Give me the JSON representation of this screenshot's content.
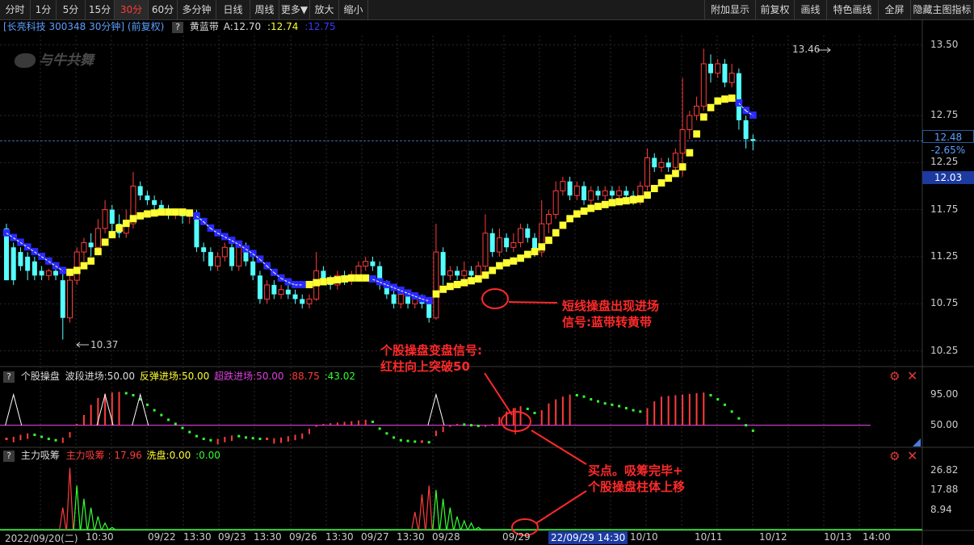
{
  "toolbar": {
    "left": [
      "分时",
      "1分",
      "5分",
      "15分",
      "30分",
      "60分",
      "多分钟",
      "日线",
      "周线",
      "更多▼",
      "放大",
      "缩小"
    ],
    "right": [
      "附加显示",
      "前复权",
      "画线",
      "特色画线",
      "全屏",
      "隐藏主图指标"
    ],
    "active": "30分"
  },
  "info": {
    "stock": "[长亮科技 300348 30分钟] (前复权)",
    "indicator_q": "?",
    "indicator": "黄蓝带",
    "a_label": "A:12.70",
    "val2": ":12.74",
    "val3": ":12.75"
  },
  "watermark": "与牛共舞",
  "price_panel": {
    "y_ticks": [
      "13.50",
      "12.75",
      "12.25",
      "11.75",
      "11.25",
      "10.75",
      "10.25"
    ],
    "high_label": "13.46",
    "low_label": "10.37",
    "last_price": "12.48",
    "last_change": "-2.65%",
    "cursor_price": "12.03"
  },
  "panel2": {
    "q": "?",
    "title": "个股操盘",
    "wave": "波段进场:50.00",
    "rebound": "反弹进场:50.00",
    "oversold": "超跌进场:50.00",
    "v1": ":88.75",
    "v2": ":43.02",
    "y_ticks": [
      "95.00",
      "50.00"
    ]
  },
  "panel3": {
    "q": "?",
    "title": "主力吸筹",
    "main": "主力吸筹 :",
    "main_val": "17.96",
    "wash": "洗盘:0.00",
    "v": ":0.00",
    "y_ticks": [
      "26.82",
      "17.88",
      "8.94"
    ]
  },
  "x_axis": {
    "labels": [
      "2022/09/20(二)",
      "10:30",
      "09/22",
      "13:30",
      "09/23",
      "13:30",
      "09/26",
      "13:30",
      "09/27",
      "13:30",
      "09/28",
      "09/29",
      "10/10",
      "10/11",
      "10/12",
      "10/13",
      "14:00"
    ],
    "cursor": "22/09/29 14:30"
  },
  "annotations": {
    "a1": [
      "短线操盘出现进场",
      "信号:蓝带转黄带"
    ],
    "a2": [
      "个股操盘变盘信号:",
      "红柱向上突破50"
    ],
    "a3": [
      "买点。吸筹完毕+",
      "个股操盘柱体上移"
    ]
  },
  "colors": {
    "up": "#ff3c3c",
    "down": "#54ffff",
    "yellow_band": "#ffff33",
    "blue_band": "#2a2aff",
    "green": "#33ff33",
    "magenta": "#e040e0",
    "annotation": "#ff2a2a"
  },
  "chart_data": {
    "type": "candlestick",
    "ylim": [
      10.1,
      13.6
    ],
    "candles": [
      [
        11.55,
        11.0,
        11.6,
        11.0
      ],
      [
        11.35,
        11.0,
        11.4,
        10.95
      ],
      [
        11.3,
        11.15,
        11.35,
        11.1
      ],
      [
        11.25,
        11.1,
        11.3,
        11.0
      ],
      [
        11.2,
        11.05,
        11.25,
        11.0
      ],
      [
        11.1,
        11.05,
        11.15,
        11.0
      ],
      [
        11.05,
        11.1,
        11.12,
        11.0
      ],
      [
        11.1,
        11.05,
        11.12,
        11.0
      ],
      [
        11.0,
        10.6,
        11.1,
        10.37
      ],
      [
        10.6,
        11.0,
        11.05,
        10.55
      ],
      [
        11.0,
        11.3,
        11.35,
        10.95
      ],
      [
        11.3,
        11.4,
        11.45,
        11.2
      ],
      [
        11.4,
        11.35,
        11.5,
        11.25
      ],
      [
        11.35,
        11.55,
        11.65,
        11.3
      ],
      [
        11.55,
        11.75,
        11.85,
        11.5
      ],
      [
        11.75,
        11.6,
        11.8,
        11.5
      ],
      [
        11.6,
        11.5,
        11.7,
        11.45
      ],
      [
        11.5,
        11.6,
        11.75,
        11.45
      ],
      [
        11.6,
        12.0,
        12.15,
        11.55
      ],
      [
        12.0,
        11.9,
        12.05,
        11.85
      ],
      [
        11.9,
        11.85,
        11.95,
        11.8
      ],
      [
        11.85,
        11.8,
        11.9,
        11.7
      ],
      [
        11.8,
        11.75,
        11.85,
        11.7
      ],
      [
        11.75,
        11.7,
        11.8,
        11.65
      ],
      [
        11.7,
        11.72,
        11.75,
        11.65
      ],
      [
        11.72,
        11.68,
        11.75,
        11.6
      ],
      [
        11.68,
        11.7,
        11.72,
        11.6
      ],
      [
        11.7,
        11.35,
        11.75,
        11.3
      ],
      [
        11.35,
        11.3,
        11.4,
        11.2
      ],
      [
        11.3,
        11.15,
        11.35,
        11.1
      ],
      [
        11.15,
        11.25,
        11.3,
        11.1
      ],
      [
        11.25,
        11.35,
        11.4,
        11.2
      ],
      [
        11.35,
        11.15,
        11.4,
        11.1
      ],
      [
        11.15,
        11.35,
        11.4,
        11.1
      ],
      [
        11.35,
        11.2,
        11.4,
        11.15
      ],
      [
        11.2,
        11.05,
        11.25,
        11.0
      ],
      [
        11.05,
        10.8,
        11.1,
        10.75
      ],
      [
        10.8,
        10.95,
        11.0,
        10.75
      ],
      [
        10.95,
        10.85,
        11.0,
        10.8
      ],
      [
        10.85,
        10.9,
        10.95,
        10.8
      ],
      [
        10.9,
        10.85,
        10.95,
        10.8
      ],
      [
        10.85,
        10.8,
        10.9,
        10.75
      ],
      [
        10.8,
        10.75,
        10.85,
        10.7
      ],
      [
        10.75,
        10.8,
        10.85,
        10.7
      ],
      [
        10.8,
        11.1,
        11.3,
        10.78
      ],
      [
        11.1,
        11.0,
        11.15,
        10.95
      ],
      [
        11.0,
        10.95,
        11.05,
        10.9
      ],
      [
        10.95,
        11.05,
        11.1,
        10.9
      ],
      [
        11.05,
        11.0,
        11.1,
        10.95
      ],
      [
        11.0,
        11.05,
        11.1,
        10.95
      ],
      [
        11.05,
        11.15,
        11.2,
        11.0
      ],
      [
        11.15,
        11.2,
        11.25,
        11.1
      ],
      [
        11.2,
        11.15,
        11.25,
        11.1
      ],
      [
        11.15,
        10.95,
        11.2,
        10.9
      ],
      [
        10.95,
        10.85,
        11.0,
        10.8
      ],
      [
        10.85,
        10.75,
        10.9,
        10.7
      ],
      [
        10.75,
        10.85,
        10.9,
        10.7
      ],
      [
        10.85,
        10.75,
        10.9,
        10.7
      ],
      [
        10.75,
        10.8,
        10.85,
        10.7
      ],
      [
        10.8,
        10.75,
        10.85,
        10.7
      ],
      [
        10.75,
        10.6,
        10.8,
        10.55
      ],
      [
        10.6,
        11.3,
        11.6,
        10.58
      ],
      [
        11.3,
        11.05,
        11.35,
        10.95
      ],
      [
        11.05,
        11.1,
        11.15,
        11.0
      ],
      [
        11.1,
        11.05,
        11.15,
        11.0
      ],
      [
        11.05,
        11.1,
        11.2,
        11.0
      ],
      [
        11.1,
        11.05,
        11.15,
        11.0
      ],
      [
        11.05,
        11.15,
        11.2,
        11.0
      ],
      [
        11.15,
        11.5,
        11.7,
        11.1
      ],
      [
        11.5,
        11.3,
        11.55,
        11.25
      ],
      [
        11.3,
        11.45,
        11.55,
        11.25
      ],
      [
        11.45,
        11.35,
        11.5,
        11.3
      ],
      [
        11.35,
        11.4,
        11.5,
        11.3
      ],
      [
        11.4,
        11.55,
        11.6,
        11.35
      ],
      [
        11.55,
        11.45,
        11.6,
        11.4
      ],
      [
        11.45,
        11.3,
        11.5,
        11.25
      ],
      [
        11.3,
        11.6,
        11.85,
        11.25
      ],
      [
        11.6,
        11.7,
        11.75,
        11.5
      ],
      [
        11.7,
        11.95,
        12.05,
        11.65
      ],
      [
        11.95,
        12.05,
        12.1,
        11.9
      ],
      [
        12.05,
        11.9,
        12.1,
        11.85
      ],
      [
        11.9,
        12.0,
        12.05,
        11.85
      ],
      [
        12.0,
        11.85,
        12.05,
        11.8
      ],
      [
        11.85,
        11.95,
        12.0,
        11.8
      ],
      [
        11.95,
        11.9,
        12.0,
        11.85
      ],
      [
        11.9,
        11.95,
        12.0,
        11.85
      ],
      [
        11.95,
        11.9,
        12.0,
        11.85
      ],
      [
        11.9,
        11.95,
        12.0,
        11.85
      ],
      [
        11.95,
        11.9,
        12.0,
        11.85
      ],
      [
        11.9,
        11.85,
        11.95,
        11.8
      ],
      [
        11.85,
        12.0,
        12.05,
        11.8
      ],
      [
        12.0,
        12.3,
        12.4,
        11.95
      ],
      [
        12.3,
        12.2,
        12.35,
        12.15
      ],
      [
        12.2,
        12.25,
        12.3,
        12.15
      ],
      [
        12.25,
        12.2,
        12.3,
        12.15
      ],
      [
        12.2,
        12.35,
        12.4,
        12.15
      ],
      [
        12.35,
        12.6,
        13.15,
        12.1
      ],
      [
        12.6,
        12.75,
        12.8,
        12.5
      ],
      [
        12.75,
        12.85,
        12.95,
        12.7
      ],
      [
        12.85,
        13.3,
        13.46,
        12.8
      ],
      [
        13.3,
        13.2,
        13.4,
        13.1
      ],
      [
        13.2,
        13.3,
        13.35,
        13.15
      ],
      [
        13.3,
        13.1,
        13.35,
        13.05
      ],
      [
        13.1,
        13.2,
        13.3,
        13.05
      ],
      [
        13.2,
        12.7,
        13.25,
        12.6
      ],
      [
        12.7,
        12.5,
        12.75,
        12.4
      ],
      [
        12.5,
        12.48,
        12.55,
        12.38
      ]
    ],
    "band": [
      11.5,
      11.45,
      11.4,
      11.35,
      11.3,
      11.25,
      11.2,
      11.15,
      11.1,
      11.08,
      11.1,
      11.15,
      11.2,
      11.3,
      11.4,
      11.48,
      11.55,
      11.6,
      11.65,
      11.68,
      11.7,
      11.71,
      11.72,
      11.72,
      11.72,
      11.72,
      11.71,
      11.68,
      11.62,
      11.55,
      11.5,
      11.46,
      11.42,
      11.38,
      11.33,
      11.28,
      11.22,
      11.15,
      11.08,
      11.02,
      10.98,
      10.95,
      10.95,
      10.95,
      10.97,
      10.98,
      10.99,
      11.0,
      11.01,
      11.02,
      11.02,
      11.02,
      11.01,
      10.98,
      10.95,
      10.92,
      10.89,
      10.86,
      10.83,
      10.8,
      10.78,
      10.85,
      10.9,
      10.93,
      10.95,
      10.97,
      10.99,
      11.01,
      11.05,
      11.1,
      11.15,
      11.18,
      11.2,
      11.23,
      11.27,
      11.3,
      11.35,
      11.42,
      11.5,
      11.58,
      11.65,
      11.7,
      11.73,
      11.76,
      11.78,
      11.8,
      11.82,
      11.83,
      11.84,
      11.85,
      11.86,
      11.9,
      11.97,
      12.03,
      12.08,
      12.13,
      12.2,
      12.35,
      12.55,
      12.73,
      12.83,
      12.9,
      12.92,
      12.93,
      12.88,
      12.8,
      12.75
    ],
    "band_is_blue": [
      1,
      1,
      1,
      1,
      1,
      1,
      1,
      1,
      1,
      0,
      0,
      0,
      0,
      0,
      0,
      0,
      0,
      0,
      0,
      0,
      0,
      0,
      0,
      0,
      0,
      0,
      0,
      1,
      1,
      1,
      1,
      1,
      1,
      1,
      1,
      1,
      1,
      1,
      1,
      1,
      1,
      1,
      1,
      0,
      0,
      0,
      0,
      0,
      0,
      0,
      0,
      0,
      1,
      1,
      1,
      1,
      1,
      1,
      1,
      1,
      1,
      0,
      0,
      0,
      0,
      0,
      0,
      0,
      0,
      0,
      0,
      0,
      0,
      0,
      0,
      0,
      0,
      0,
      0,
      0,
      0,
      0,
      0,
      0,
      0,
      0,
      0,
      0,
      0,
      0,
      0,
      0,
      0,
      0,
      0,
      0,
      0,
      0,
      0,
      0,
      0,
      0,
      0,
      0,
      1,
      1,
      1
    ],
    "osc_ylim": [
      20,
      110
    ],
    "osc": [
      30,
      33,
      36,
      38,
      36,
      33,
      30,
      28,
      32,
      40,
      52,
      65,
      80,
      90,
      96,
      98,
      99,
      97,
      94,
      88,
      80,
      72,
      65,
      58,
      52,
      46,
      40,
      34,
      30,
      28,
      30,
      33,
      35,
      34,
      32,
      31,
      30,
      30,
      31,
      32,
      34,
      36,
      38,
      45,
      50,
      52,
      53,
      54,
      55,
      56,
      57,
      58,
      55,
      45,
      38,
      32,
      28,
      27,
      26,
      26,
      25,
      42,
      48,
      50,
      52,
      51,
      50,
      49,
      50,
      52,
      62,
      70,
      75,
      78,
      74,
      68,
      72,
      82,
      88,
      92,
      95,
      94,
      92,
      88,
      85,
      82,
      80,
      78,
      75,
      72,
      70,
      75,
      85,
      92,
      93,
      94,
      95,
      96,
      97,
      98,
      94,
      88,
      80,
      70,
      60,
      50,
      42
    ],
    "osc_mark_idx": [
      1,
      14,
      19,
      61
    ],
    "chip_ylim": [
      0,
      30
    ],
    "chip": [
      0,
      0,
      0,
      0,
      0,
      0,
      0,
      0,
      10,
      28,
      20,
      14,
      10,
      6,
      3,
      1,
      0,
      0,
      0,
      0,
      0,
      0,
      0,
      0,
      0,
      0,
      0,
      0,
      0,
      0,
      0,
      0,
      0,
      0,
      0,
      0,
      0,
      0,
      0,
      0,
      0,
      0,
      0,
      0,
      0,
      0,
      0,
      0,
      0,
      0,
      0,
      0,
      0,
      0,
      0,
      0,
      0,
      0,
      8,
      16,
      20,
      18,
      14,
      10,
      6,
      4,
      3,
      1,
      0,
      0,
      0,
      0,
      0,
      0,
      0,
      0,
      0,
      0,
      0,
      0,
      0,
      0,
      0,
      0,
      0,
      0,
      0,
      0,
      0,
      0,
      0,
      0,
      0,
      0,
      0,
      0,
      0,
      0,
      0,
      0,
      0,
      0,
      0,
      0,
      0,
      0,
      0
    ]
  }
}
